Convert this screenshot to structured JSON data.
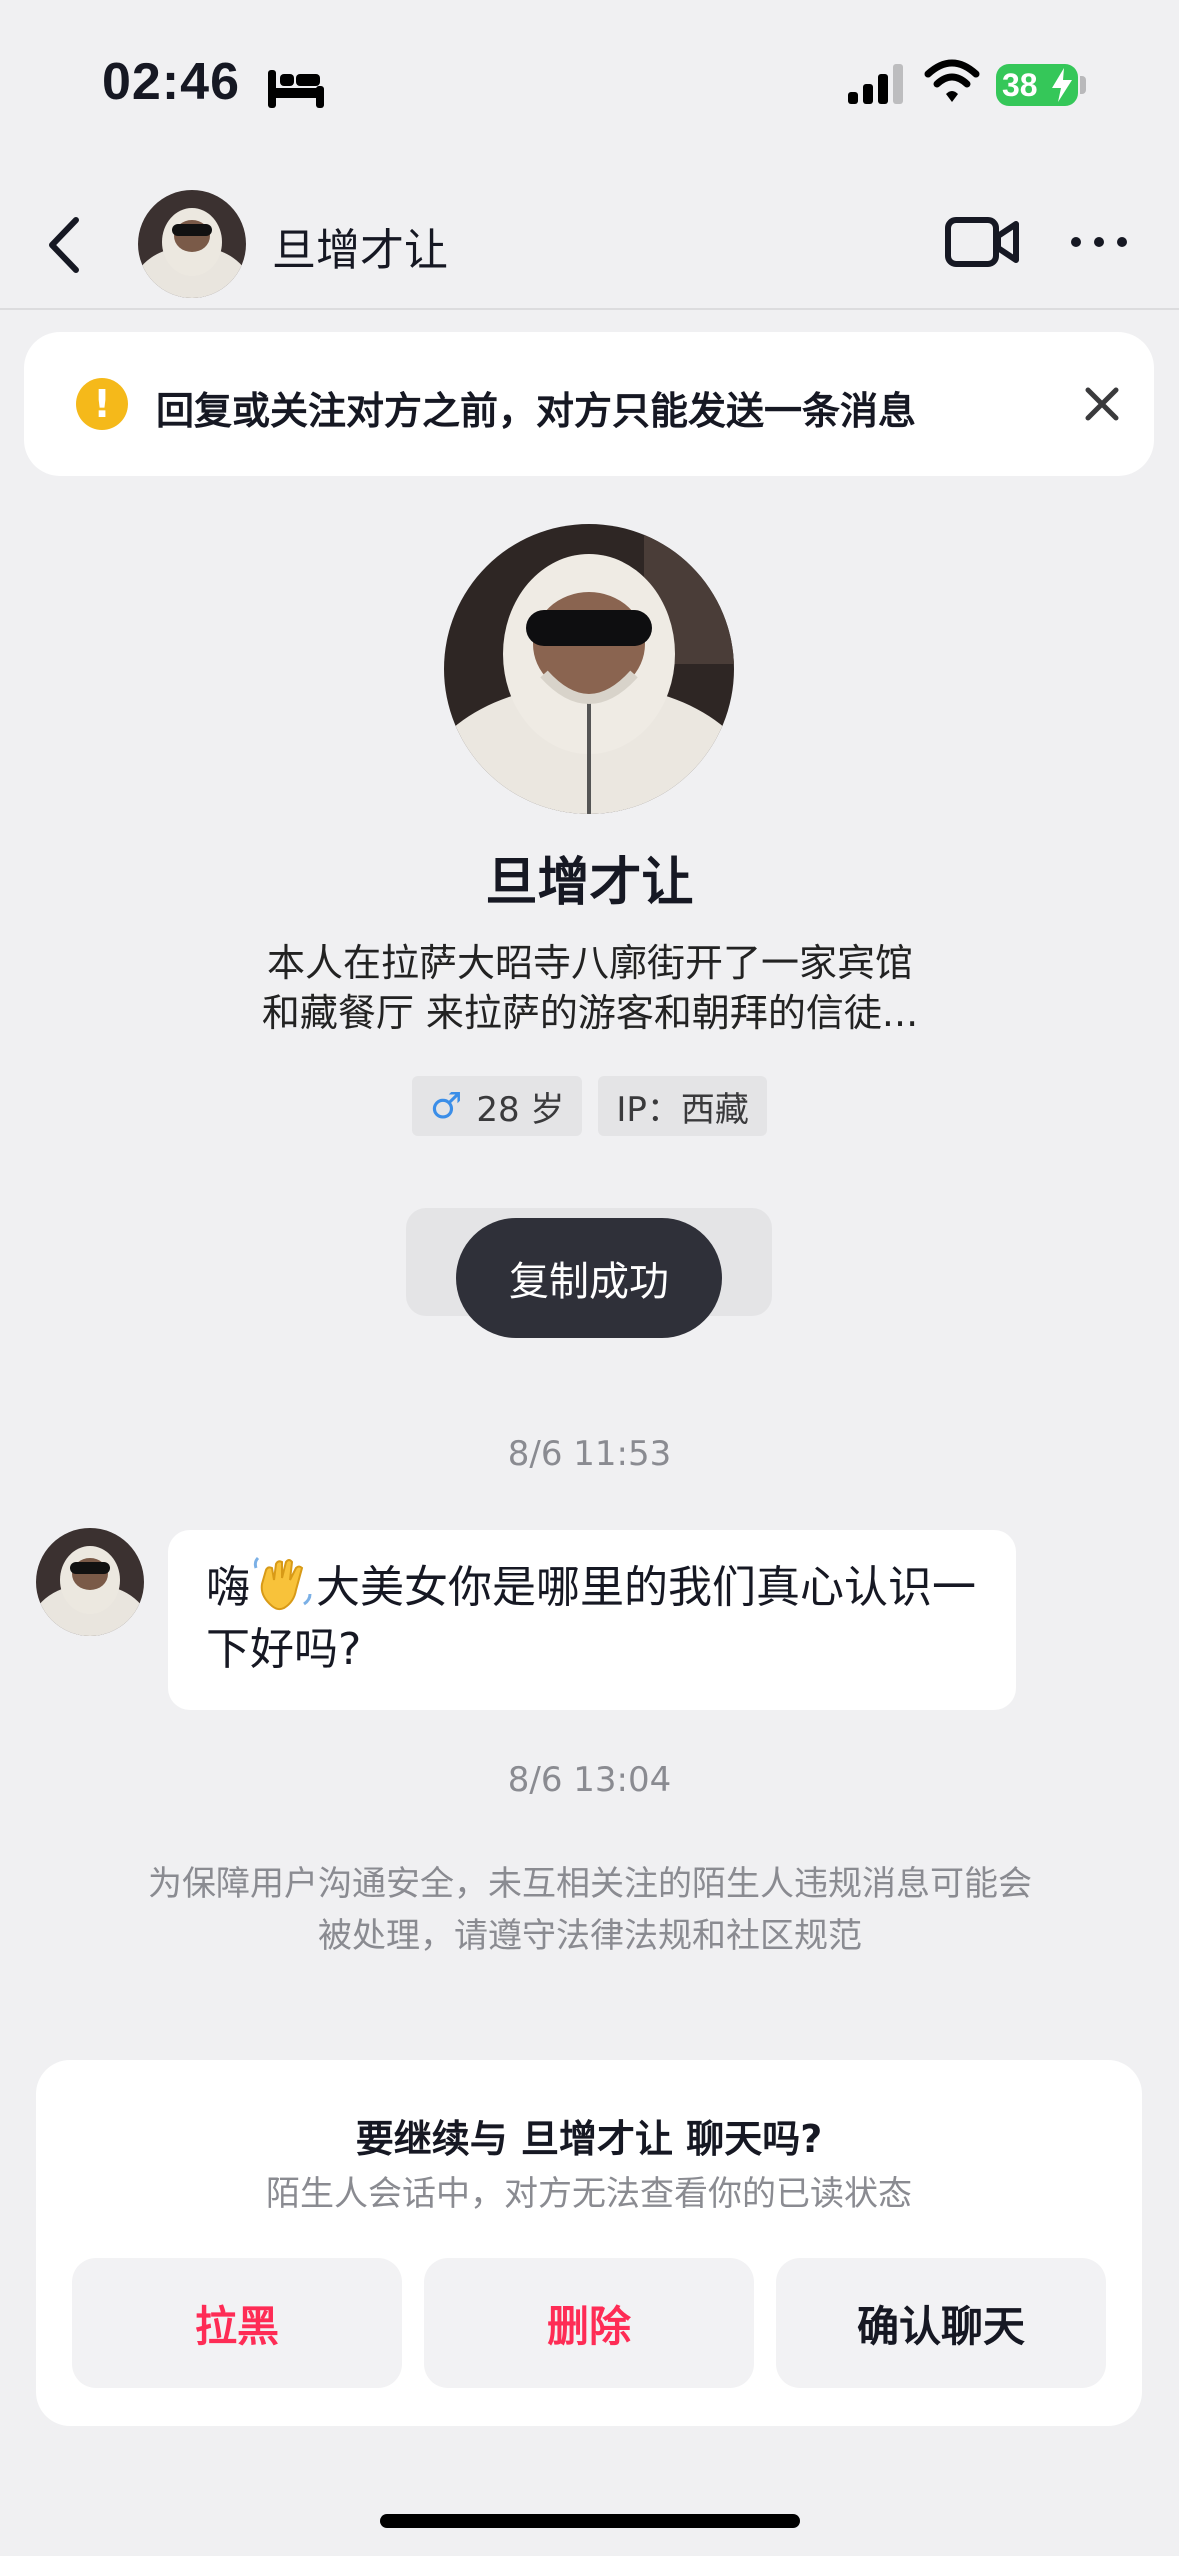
{
  "status_bar": {
    "time": "02:46",
    "battery": "38"
  },
  "nav": {
    "name": "旦增才让"
  },
  "notice": {
    "text": "回复或关注对方之前，对方只能发送一条消息",
    "icon": "!"
  },
  "profile": {
    "name": "旦增才让",
    "bio_line1": "本人在拉萨大昭寺八廓街开了一家宾馆",
    "bio_line2": "和藏餐厅 来拉萨的游客和朝拜的信徒...",
    "gender_symbol": "♂",
    "age": "28 岁",
    "ip": "IP：西藏"
  },
  "toast": {
    "text": "复制成功"
  },
  "chat": {
    "timestamp1": "8/6 11:53",
    "message_pre": "嗨",
    "message_post": "大美女你是哪里的我们真心认识一下好吗?",
    "timestamp2": "8/6 13:04",
    "safety_notice": "为保障用户沟通安全，未互相关注的陌生人违规消息可能会被处理，请遵守法律法规和社区规范"
  },
  "panel": {
    "title": "要继续与 旦增才让 聊天吗?",
    "subtitle": "陌生人会话中，对方无法查看你的已读状态",
    "block_label": "拉黑",
    "delete_label": "删除",
    "confirm_label": "确认聊天"
  },
  "colors": {
    "accent_red": "#fe2c55",
    "warning": "#f5b91a",
    "male_blue": "#3b8ee8",
    "battery_green": "#35c759"
  },
  "icons": [
    "bed-icon",
    "signal-icon",
    "wifi-icon",
    "bolt-icon",
    "back-icon",
    "video-icon",
    "more-icon",
    "warning-icon",
    "close-icon",
    "male-icon",
    "waving-hand-icon"
  ]
}
